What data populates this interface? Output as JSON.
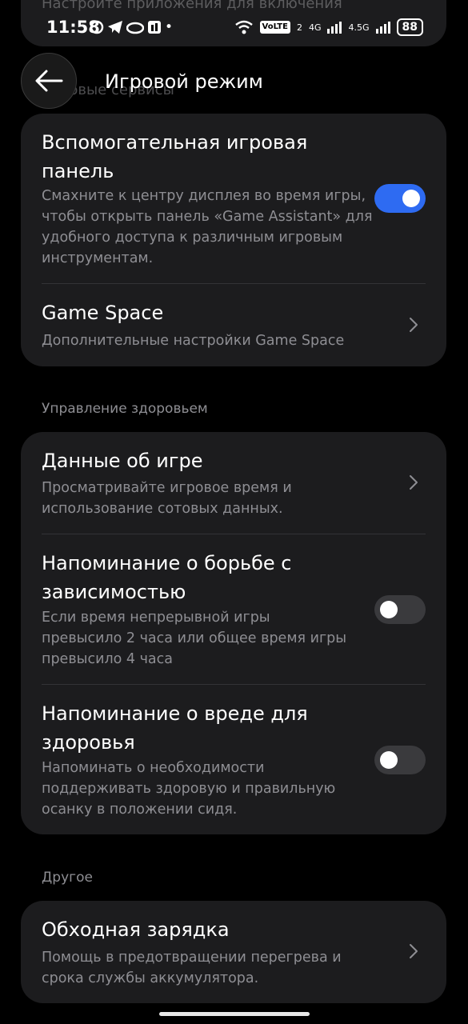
{
  "status_bar": {
    "partial_text": "Настройте приложения для включения",
    "time": "11:58",
    "notification_icons": [
      "chat-icon",
      "telegram-icon",
      "cloud-icon",
      "app-icon"
    ],
    "volte": "VoLTE",
    "sim_number": "2",
    "network_1": "4G",
    "network_2": "4.5G",
    "battery": "88"
  },
  "header": {
    "title": "Игровой режим",
    "ghost_text": "Игровые сервисы"
  },
  "game_card": {
    "assistant": {
      "title": "Вспомогательная игровая панель",
      "subtitle": "Смахните к центру дисплея во время игры, чтобы открыть панель «Game Assistant» для удобного доступа к различным игровым инструментам.",
      "enabled": true
    },
    "game_space": {
      "title": "Game Space",
      "subtitle": "Дополнительные настройки Game Space"
    }
  },
  "health_section": {
    "label": "Управление здоровьем",
    "game_data": {
      "title": "Данные об игре",
      "subtitle": "Просматривайте игровое время и использование сотовых данных."
    },
    "addiction_reminder": {
      "title": "Напоминание о борьбе с зависимостью",
      "subtitle": "Если время непрерывной игры превысило 2 часа или общее время игры превысило 4 часа",
      "enabled": false
    },
    "health_reminder": {
      "title": "Напоминание о вреде для здоровья",
      "subtitle": "Напоминать о необходимости поддерживать здоровую и правильную осанку в положении сидя.",
      "enabled": false
    }
  },
  "other_section": {
    "label": "Другое",
    "bypass_charging": {
      "title": "Обходная зарядка",
      "subtitle": "Помощь в предотвращении перегрева и срока службы аккумулятора."
    }
  },
  "colors": {
    "background": "#000000",
    "card": "#1c1c1e",
    "accent": "#2e6bf2",
    "secondary_text": "#8e8e93"
  }
}
